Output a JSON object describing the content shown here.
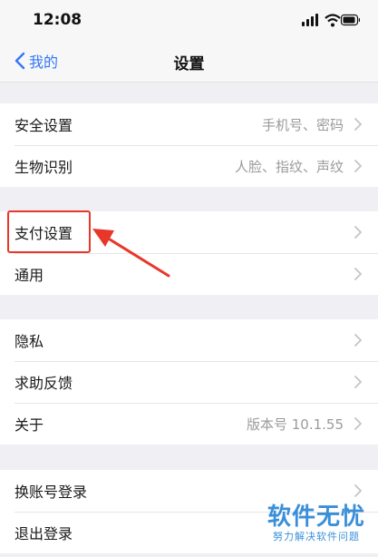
{
  "status_bar": {
    "time": "12:08"
  },
  "nav": {
    "back_label": "我的",
    "title": "设置"
  },
  "groups": [
    {
      "rows": [
        {
          "label": "安全设置",
          "value": "手机号、密码"
        },
        {
          "label": "生物识别",
          "value": "人脸、指纹、声纹"
        }
      ]
    },
    {
      "rows": [
        {
          "label": "支付设置",
          "value": ""
        },
        {
          "label": "通用",
          "value": ""
        }
      ]
    },
    {
      "rows": [
        {
          "label": "隐私",
          "value": ""
        },
        {
          "label": "求助反馈",
          "value": ""
        },
        {
          "label": "关于",
          "value": "版本号 10.1.55"
        }
      ]
    },
    {
      "rows": [
        {
          "label": "换账号登录",
          "value": ""
        },
        {
          "label": "退出登录",
          "value": ""
        }
      ]
    }
  ],
  "watermark": {
    "main": "软件无忧",
    "sub": "努力解决软件问题"
  },
  "colors": {
    "accent": "#3478f6",
    "annotation": "#e8372a",
    "watermark": "#3a8fd9"
  }
}
